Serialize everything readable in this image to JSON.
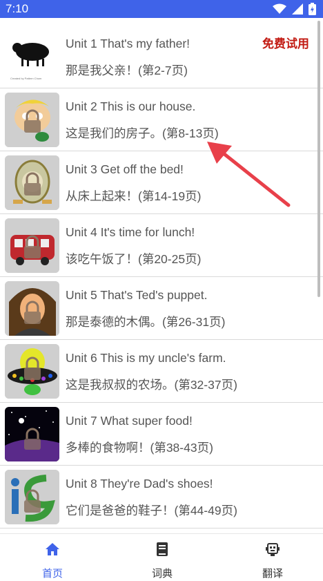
{
  "status_bar": {
    "time": "7:10",
    "icons": [
      "signal-icon",
      "wifi-icon",
      "battery-icon"
    ],
    "color": "#3f63e9"
  },
  "list": {
    "badge": "免费试用",
    "items": [
      {
        "title": "Unit 1 That's my father!",
        "subtitle": "那是我父亲！(第2-7页)",
        "thumb": "sheep"
      },
      {
        "title": "Unit 2 This is our house.",
        "subtitle": "这是我们的房子。(第8-13页)",
        "thumb": "boy-locked"
      },
      {
        "title": "Unit 3 Get off the bed!",
        "subtitle": "从床上起来！(第14-19页)",
        "thumb": "clock-locked"
      },
      {
        "title": "Unit 4 It's time for lunch!",
        "subtitle": "该吃午饭了！(第20-25页)",
        "thumb": "bus-locked"
      },
      {
        "title": "Unit 5 That's Ted's puppet.",
        "subtitle": "那是泰德的木偶。(第26-31页)",
        "thumb": "woman-locked"
      },
      {
        "title": "Unit 6 This is my uncle's farm.",
        "subtitle": "这是我叔叔的农场。(第32-37页)",
        "thumb": "ufo-locked"
      },
      {
        "title": "Unit 7 What super food!",
        "subtitle": "多棒的食物啊！(第38-43页)",
        "thumb": "space-locked"
      },
      {
        "title": "Unit 8 They're Dad's shoes!",
        "subtitle": "它们是爸爸的鞋子！(第44-49页)",
        "thumb": "logo-locked"
      }
    ]
  },
  "thumb1_caption": "Created by Pattern Chom",
  "bottom_nav": {
    "items": [
      {
        "label": "首页",
        "icon": "home-icon",
        "active": true
      },
      {
        "label": "词典",
        "icon": "book-icon",
        "active": false
      },
      {
        "label": "翻译",
        "icon": "robot-icon",
        "active": false
      }
    ],
    "accent": "#3f63e9"
  },
  "colors": {
    "badge": "#c21a12",
    "arrow": "#e8404a"
  }
}
